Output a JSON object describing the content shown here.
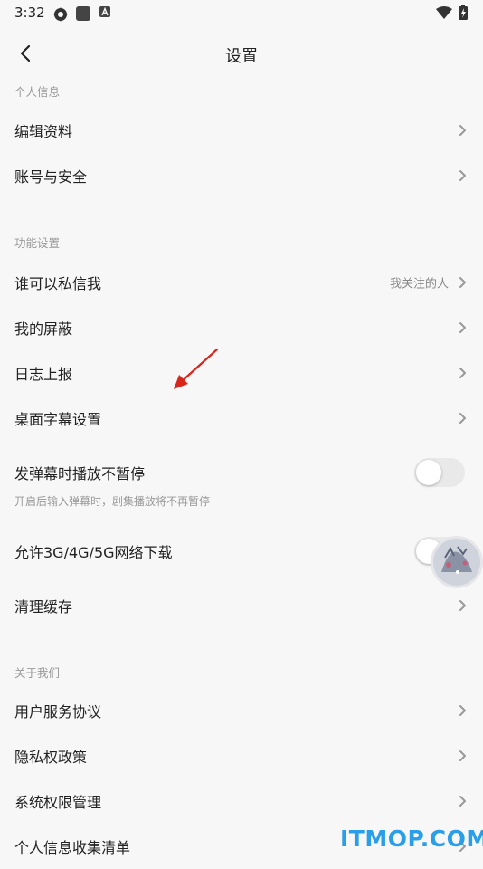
{
  "status_bar": {
    "time": "3:32"
  },
  "header": {
    "title": "设置"
  },
  "sections": {
    "personal": "个人信息",
    "function": "功能设置",
    "about": "关于我们"
  },
  "rows": {
    "edit_profile": "编辑资料",
    "account_security": "账号与安全",
    "who_can_message": "谁可以私信我",
    "who_can_message_value": "我关注的人",
    "my_blocks": "我的屏蔽",
    "log_report": "日志上报",
    "desktop_subtitle": "桌面字幕设置",
    "danmaku_no_pause": "发弹幕时播放不暂停",
    "danmaku_no_pause_hint": "开启后输入弹幕时，剧集播放将不再暂停",
    "allow_mobile_download": "允许3G/4G/5G网络下载",
    "clear_cache": "清理缓存",
    "user_agreement": "用户服务协议",
    "privacy_policy": "隐私权政策",
    "system_permissions": "系统权限管理",
    "personal_info_list": "个人信息收集清单"
  },
  "toggles": {
    "danmaku_no_pause": false,
    "allow_mobile_download": false
  },
  "watermark": "ITMOP.COM",
  "colors": {
    "background": "#f7f7f7",
    "annotation_arrow": "#d9261c",
    "watermark": "#2a9ee8"
  },
  "icons": [
    "gear-icon",
    "stop-icon",
    "a-notification-icon",
    "wifi-icon",
    "battery-icon",
    "back-chevron-icon",
    "chevron-right-icon"
  ]
}
